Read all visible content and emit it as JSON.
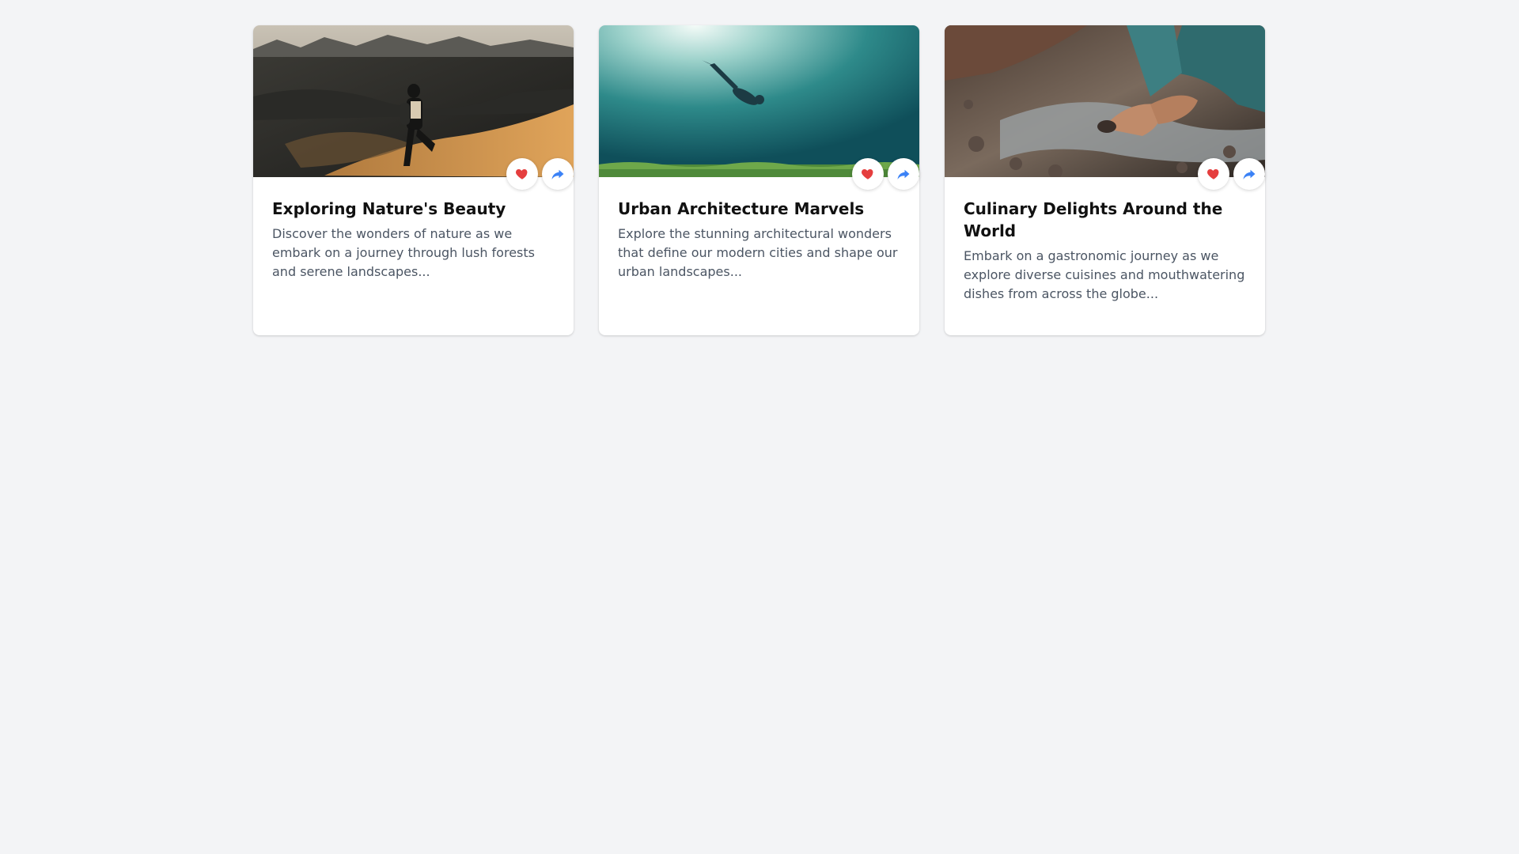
{
  "cards": [
    {
      "title": "Exploring Nature's Beauty",
      "description": "Discover the wonders of nature as we embark on a journey through lush forests and serene landscapes...",
      "image_icon": "desert-hiker-photo"
    },
    {
      "title": "Urban Architecture Marvels",
      "description": "Explore the stunning architectural wonders that define our modern cities and shape our urban landscapes...",
      "image_icon": "underwater-diver-photo"
    },
    {
      "title": "Culinary Delights Around the World",
      "description": "Embark on a gastronomic journey as we explore diverse cuisines and mouthwatering dishes from across the globe...",
      "image_icon": "river-stones-photo"
    }
  ],
  "colors": {
    "background": "#f3f4f6",
    "like": "#e53e3e",
    "share": "#3b82f6"
  },
  "icons": {
    "like": "heart-icon",
    "share": "share-icon"
  }
}
